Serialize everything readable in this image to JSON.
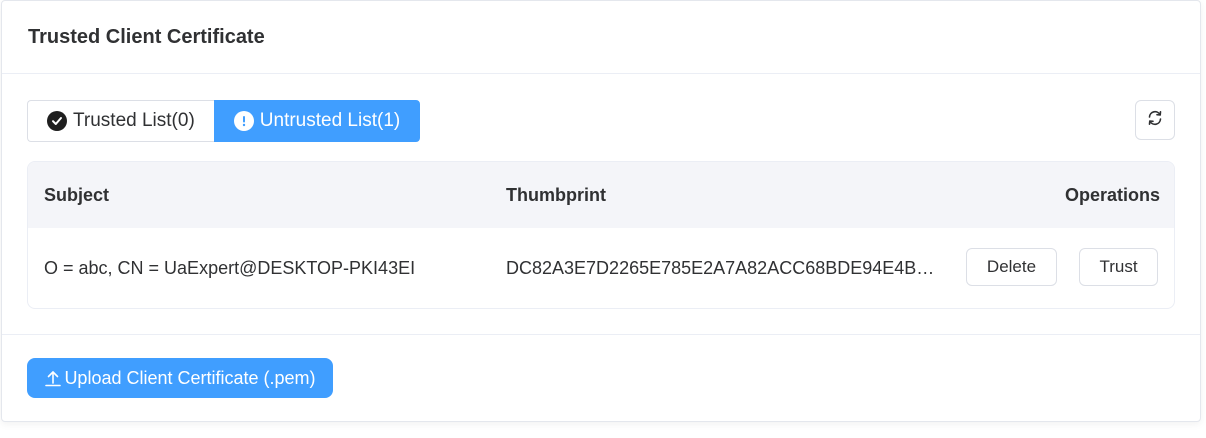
{
  "card": {
    "title": "Trusted Client Certificate"
  },
  "tabs": [
    {
      "label": "Trusted List(0)",
      "icon": "check-circle-icon",
      "active": false
    },
    {
      "label": "Untrusted List(1)",
      "icon": "exclamation-circle-icon",
      "active": true
    }
  ],
  "toolbar": {
    "refresh_icon": "refresh-icon"
  },
  "table": {
    "columns": [
      "Subject",
      "Thumbprint",
      "Operations"
    ],
    "rows": [
      {
        "subject": "O = abc, CN = UaExpert@DESKTOP-PKI43EI",
        "thumbprint": "DC82A3E7D2265E785E2A7A82ACC68BDE94E4B8...",
        "actions": [
          "Delete",
          "Trust"
        ]
      }
    ]
  },
  "footer": {
    "upload_label": "Upload Client Certificate (.pem)",
    "upload_icon": "upload-icon"
  },
  "colors": {
    "accent": "#409eff",
    "header_bg": "#f4f5f9",
    "border": "#dcdfe6"
  }
}
